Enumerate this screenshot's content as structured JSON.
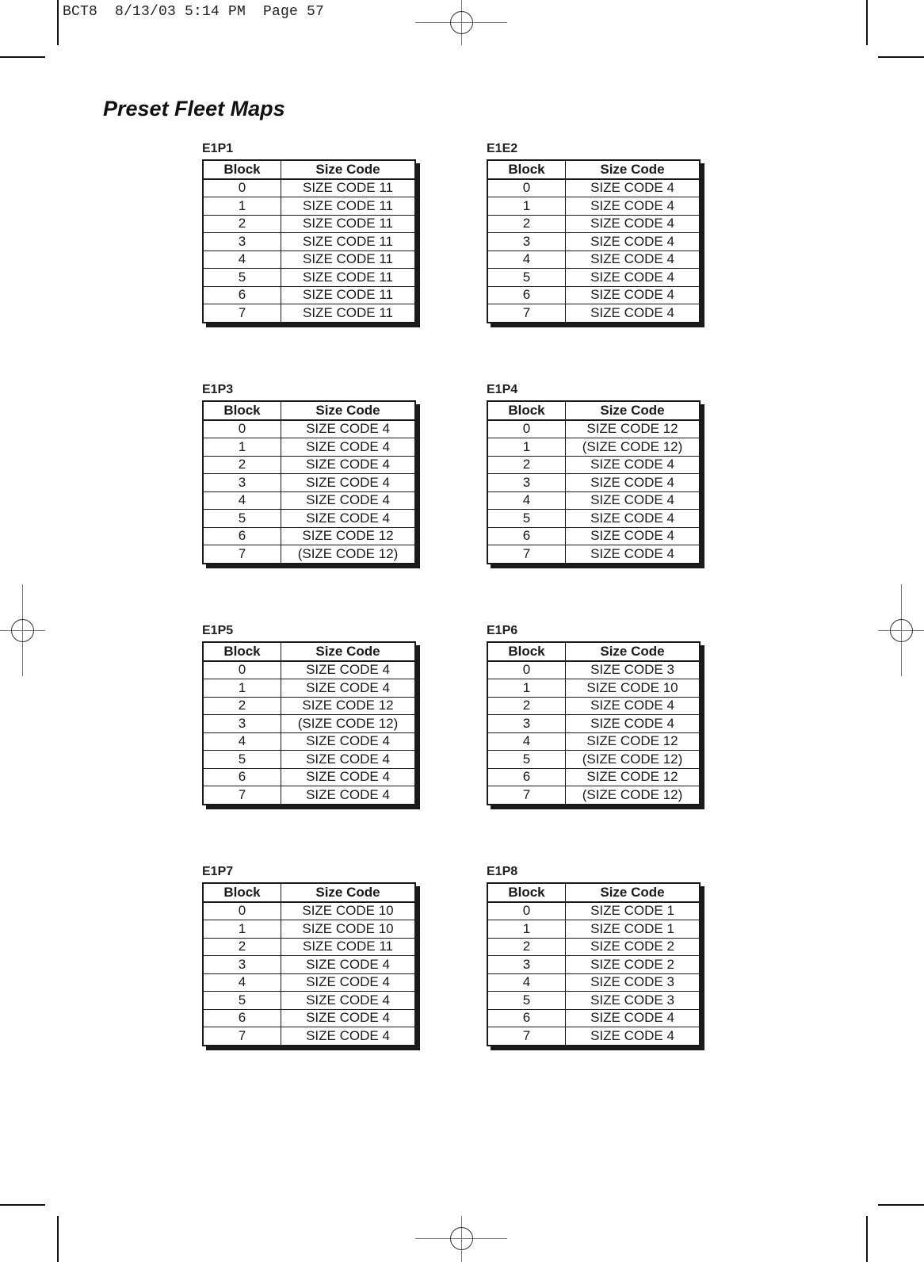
{
  "slug_line": "BCT8  8/13/03 5:14 PM  Page 57",
  "page_title": "Preset Fleet Maps",
  "column_headers": {
    "block": "Block",
    "size_code": "Size Code"
  },
  "maps": [
    {
      "name": "E1P1",
      "rows": [
        {
          "block": "0",
          "size_code": "SIZE CODE 11"
        },
        {
          "block": "1",
          "size_code": "SIZE CODE 11"
        },
        {
          "block": "2",
          "size_code": "SIZE CODE 11"
        },
        {
          "block": "3",
          "size_code": "SIZE CODE 11"
        },
        {
          "block": "4",
          "size_code": "SIZE CODE 11"
        },
        {
          "block": "5",
          "size_code": "SIZE CODE 11"
        },
        {
          "block": "6",
          "size_code": "SIZE CODE 11"
        },
        {
          "block": "7",
          "size_code": "SIZE CODE 11"
        }
      ]
    },
    {
      "name": "E1E2",
      "rows": [
        {
          "block": "0",
          "size_code": "SIZE CODE 4"
        },
        {
          "block": "1",
          "size_code": "SIZE CODE 4"
        },
        {
          "block": "2",
          "size_code": "SIZE CODE 4"
        },
        {
          "block": "3",
          "size_code": "SIZE CODE 4"
        },
        {
          "block": "4",
          "size_code": "SIZE CODE 4"
        },
        {
          "block": "5",
          "size_code": "SIZE CODE 4"
        },
        {
          "block": "6",
          "size_code": "SIZE CODE 4"
        },
        {
          "block": "7",
          "size_code": "SIZE CODE 4"
        }
      ]
    },
    {
      "name": "E1P3",
      "rows": [
        {
          "block": "0",
          "size_code": "SIZE CODE 4"
        },
        {
          "block": "1",
          "size_code": "SIZE CODE 4"
        },
        {
          "block": "2",
          "size_code": "SIZE CODE 4"
        },
        {
          "block": "3",
          "size_code": "SIZE CODE 4"
        },
        {
          "block": "4",
          "size_code": "SIZE CODE 4"
        },
        {
          "block": "5",
          "size_code": "SIZE CODE 4"
        },
        {
          "block": "6",
          "size_code": "SIZE CODE 12"
        },
        {
          "block": "7",
          "size_code": "(SIZE CODE 12)"
        }
      ]
    },
    {
      "name": "E1P4",
      "rows": [
        {
          "block": "0",
          "size_code": "SIZE CODE 12"
        },
        {
          "block": "1",
          "size_code": "(SIZE CODE 12)"
        },
        {
          "block": "2",
          "size_code": "SIZE CODE 4"
        },
        {
          "block": "3",
          "size_code": "SIZE CODE 4"
        },
        {
          "block": "4",
          "size_code": "SIZE CODE 4"
        },
        {
          "block": "5",
          "size_code": "SIZE CODE 4"
        },
        {
          "block": "6",
          "size_code": "SIZE CODE 4"
        },
        {
          "block": "7",
          "size_code": "SIZE CODE 4"
        }
      ]
    },
    {
      "name": "E1P5",
      "rows": [
        {
          "block": "0",
          "size_code": "SIZE CODE 4"
        },
        {
          "block": "1",
          "size_code": "SIZE CODE 4"
        },
        {
          "block": "2",
          "size_code": "SIZE CODE 12"
        },
        {
          "block": "3",
          "size_code": "(SIZE CODE 12)"
        },
        {
          "block": "4",
          "size_code": "SIZE CODE 4"
        },
        {
          "block": "5",
          "size_code": "SIZE CODE 4"
        },
        {
          "block": "6",
          "size_code": "SIZE CODE 4"
        },
        {
          "block": "7",
          "size_code": "SIZE CODE 4"
        }
      ]
    },
    {
      "name": "E1P6",
      "rows": [
        {
          "block": "0",
          "size_code": "SIZE CODE 3"
        },
        {
          "block": "1",
          "size_code": "SIZE CODE 10"
        },
        {
          "block": "2",
          "size_code": "SIZE CODE 4"
        },
        {
          "block": "3",
          "size_code": "SIZE CODE 4"
        },
        {
          "block": "4",
          "size_code": "SIZE CODE 12"
        },
        {
          "block": "5",
          "size_code": "(SIZE CODE 12)"
        },
        {
          "block": "6",
          "size_code": "SIZE CODE 12"
        },
        {
          "block": "7",
          "size_code": "(SIZE CODE 12)"
        }
      ]
    },
    {
      "name": "E1P7",
      "rows": [
        {
          "block": "0",
          "size_code": "SIZE CODE 10"
        },
        {
          "block": "1",
          "size_code": "SIZE CODE 10"
        },
        {
          "block": "2",
          "size_code": "SIZE CODE 11"
        },
        {
          "block": "3",
          "size_code": "SIZE CODE 4"
        },
        {
          "block": "4",
          "size_code": "SIZE CODE 4"
        },
        {
          "block": "5",
          "size_code": "SIZE CODE 4"
        },
        {
          "block": "6",
          "size_code": "SIZE CODE 4"
        },
        {
          "block": "7",
          "size_code": "SIZE CODE 4"
        }
      ]
    },
    {
      "name": "E1P8",
      "rows": [
        {
          "block": "0",
          "size_code": "SIZE CODE 1"
        },
        {
          "block": "1",
          "size_code": "SIZE CODE 1"
        },
        {
          "block": "2",
          "size_code": "SIZE CODE 2"
        },
        {
          "block": "3",
          "size_code": "SIZE CODE 2"
        },
        {
          "block": "4",
          "size_code": "SIZE CODE 3"
        },
        {
          "block": "5",
          "size_code": "SIZE CODE 3"
        },
        {
          "block": "6",
          "size_code": "SIZE CODE 4"
        },
        {
          "block": "7",
          "size_code": "SIZE CODE 4"
        }
      ]
    }
  ]
}
